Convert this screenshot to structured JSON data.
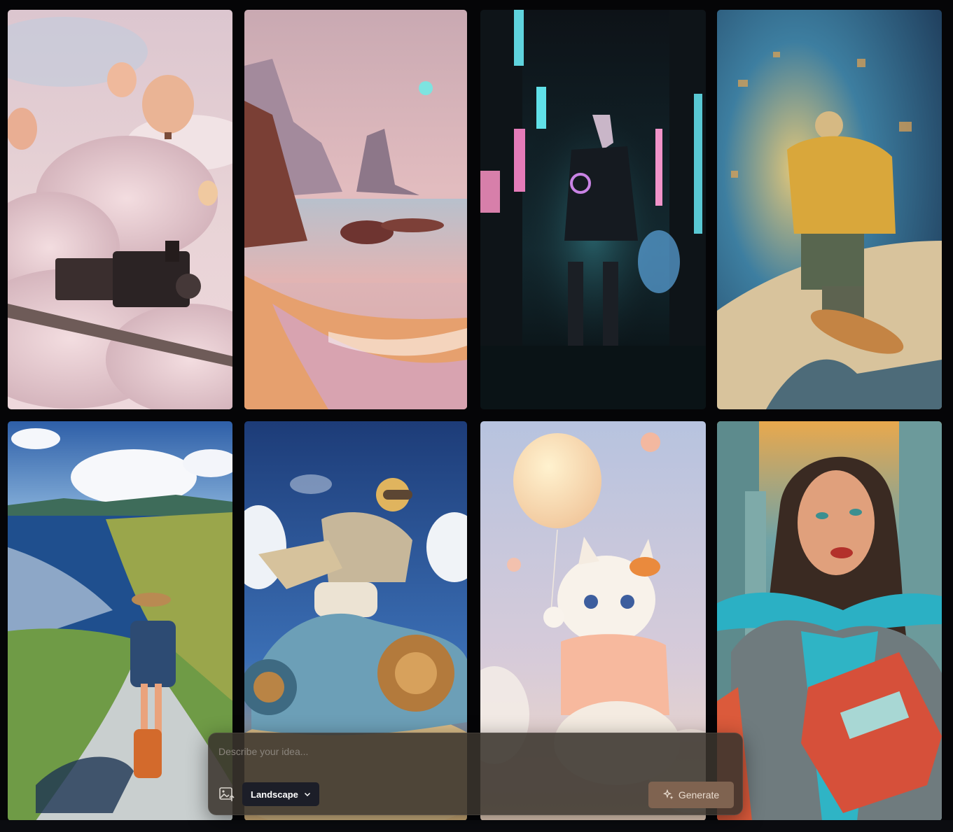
{
  "gallery": {
    "images": [
      {
        "name": "train-in-clouds-with-balloons"
      },
      {
        "name": "pink-sunset-beach-cliffs"
      },
      {
        "name": "cyberpunk-cat-warrior-neon-street"
      },
      {
        "name": "skateboarder-yellow-jacket-city"
      },
      {
        "name": "girl-skateboarding-coastal-road"
      },
      {
        "name": "boy-riding-blue-motorbike"
      },
      {
        "name": "kitten-holding-balloon"
      },
      {
        "name": "comic-woman-with-books"
      }
    ]
  },
  "composer": {
    "placeholder": "Describe your idea...",
    "upload_icon": "image-upload-icon",
    "aspect_ratio": "Landscape",
    "generate_label": "Generate",
    "generate_icon": "sparkle-icon"
  },
  "colors": {
    "background": "#050507",
    "composer_bg": "#3a342e",
    "select_bg": "#1c1e28",
    "generate_bg": "#7f6350"
  }
}
